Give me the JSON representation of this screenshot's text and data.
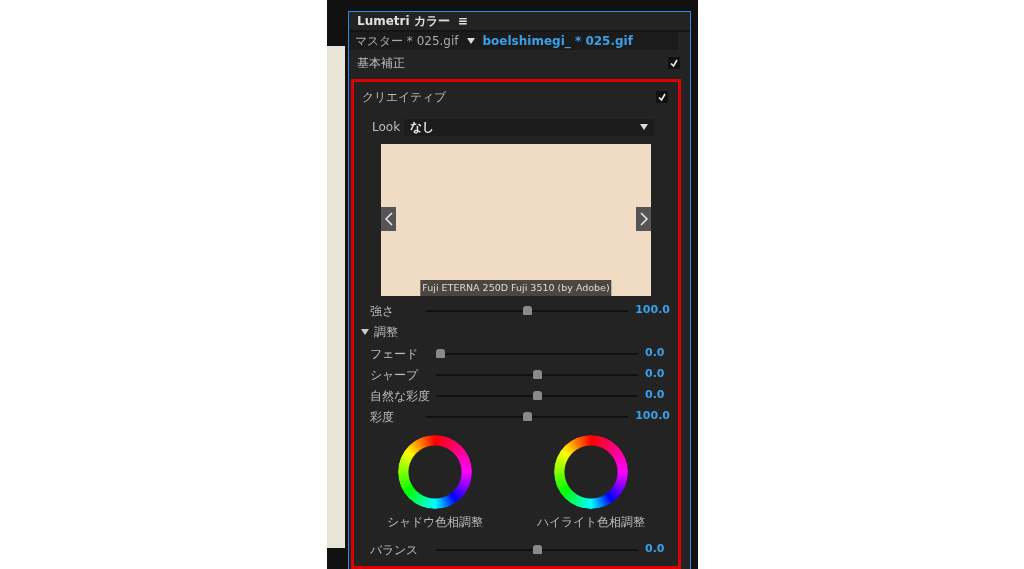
{
  "panel": {
    "title": "Lumetri カラー",
    "menu_glyph": "≡"
  },
  "clip_bar": {
    "master": "マスター * 025.gif",
    "clip": "boelshimegi_ * 025.gif"
  },
  "sections": [
    {
      "title": "基本補正",
      "checked": true,
      "highlighted": false
    },
    {
      "title": "クリエイティブ",
      "checked": true,
      "highlighted": true
    }
  ],
  "look": {
    "label": "Look",
    "value": "なし"
  },
  "preview": {
    "caption": "Fuji ETERNA 250D Fuji 3510 (by Adobe)"
  },
  "intensity": {
    "label": "強さ",
    "level": 0.5,
    "reading": "100.0"
  },
  "adjust": {
    "title": "調整",
    "expanded": true,
    "sliders": [
      {
        "label": "フェード",
        "level": 0,
        "reading": "0.0"
      },
      {
        "label": "シャープ",
        "level": 0.5,
        "reading": "0.0"
      },
      {
        "label": "自然な彩度",
        "level": 0.5,
        "reading": "0.0"
      },
      {
        "label": "彩度",
        "level": 0.5,
        "reading": "100.0"
      }
    ],
    "wheels": [
      {
        "label": "シャドウ色相調整"
      },
      {
        "label": "ハイライト色相調整"
      }
    ],
    "balance": {
      "label": "バランス",
      "level": 0.5,
      "reading": "0.0"
    }
  }
}
